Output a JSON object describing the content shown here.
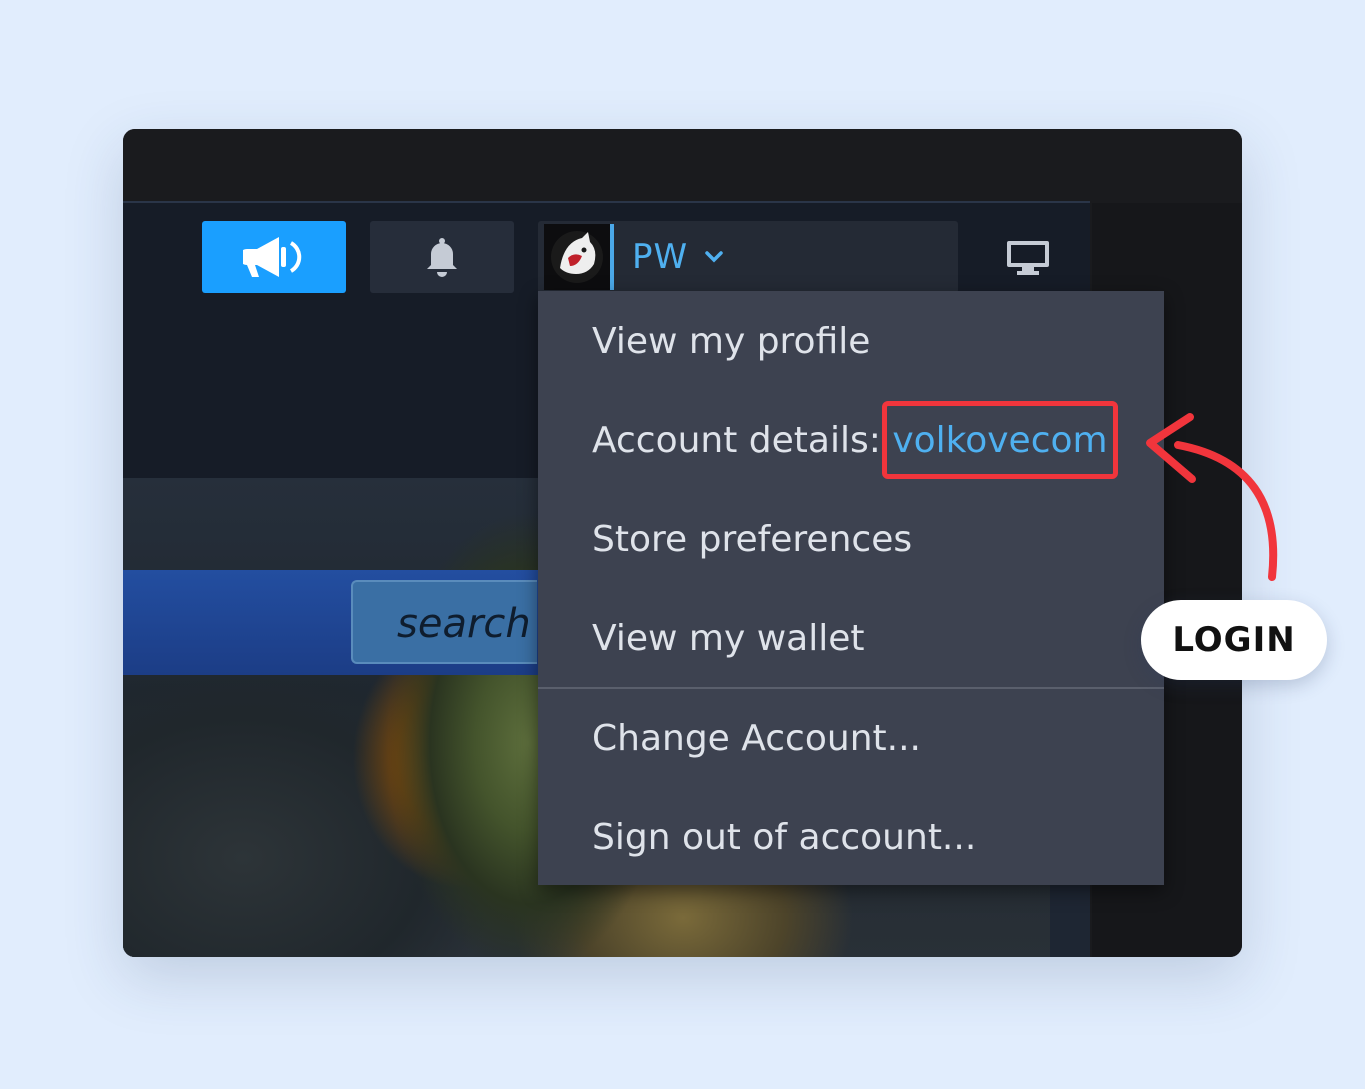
{
  "header": {
    "account_name": "PW"
  },
  "search": {
    "button_label": "search"
  },
  "account_menu": {
    "items": [
      {
        "label": "View my profile"
      },
      {
        "label": "Account details: ",
        "username": "volkovecom"
      },
      {
        "label": "Store preferences"
      },
      {
        "label": "View my wallet"
      },
      {
        "label": "Change Account..."
      },
      {
        "label": "Sign out of account..."
      }
    ]
  },
  "annotation": {
    "label": "LOGIN",
    "highlight_color": "#f1353c"
  },
  "colors": {
    "accent": "#1a9fff",
    "link": "#4fb0f0",
    "menu_bg": "#3d4250",
    "page_bg": "#e1edfd"
  },
  "icons": {
    "announce": "megaphone-icon",
    "notifications": "bell-icon",
    "avatar": "wolf-avatar-icon",
    "dropdown": "chevron-down-icon",
    "display": "monitor-icon"
  }
}
